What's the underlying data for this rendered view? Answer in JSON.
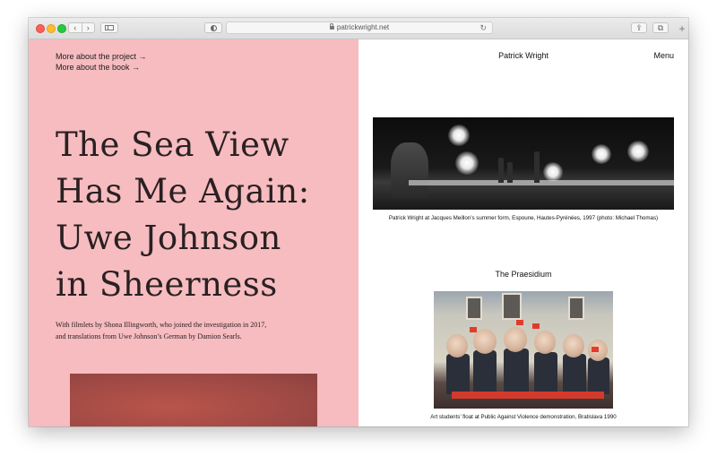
{
  "browser": {
    "url": "patrickwright.net",
    "reload_glyph": "↻",
    "new_tab_glyph": "+",
    "back_glyph": "‹",
    "forward_glyph": "›",
    "share_glyph": "⇪",
    "tabs_glyph": "⧉"
  },
  "left_panel": {
    "background": "#f6bcc0",
    "links": [
      {
        "label": "More about the project →"
      },
      {
        "label": "More about the book →"
      }
    ],
    "title_lines": [
      "The Sea View",
      "Has Me Again:",
      "Uwe Johnson",
      "in Sheerness"
    ],
    "subtitle_lines": [
      "With filmlets by Shona Illingworth, who joined the investigation in 2017,",
      "and translations from Uwe Johnson’s German by Damion Searls."
    ]
  },
  "right_panel": {
    "site_title": "Patrick Wright",
    "menu_label": "Menu",
    "photo1_caption": "Patrick Wright at Jacques Meillon’s summer form, Espoune, Hautes-Pyrénées, 1997 (photo: Michael Thomas)",
    "section_heading": "The Praesidium",
    "photo2_caption": "Art students’ float at Public Against Violence demonstration, Bratislava 1990"
  }
}
